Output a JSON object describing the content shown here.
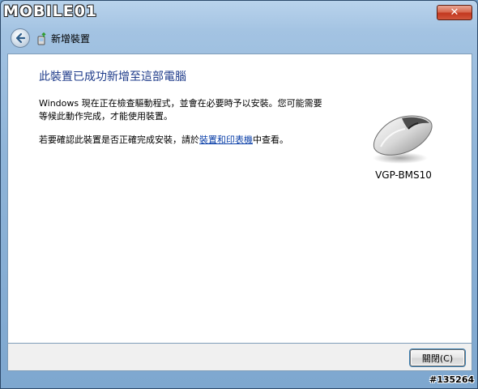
{
  "watermark": {
    "logo_text": "MOBILE01",
    "id": "#135264"
  },
  "titlebar": {
    "close_label": "✕"
  },
  "nav": {
    "title": "新增裝置"
  },
  "content": {
    "heading": "此裝置已成功新增至這部電腦",
    "para1": "Windows 現在正在檢查驅動程式，並會在必要時予以安裝。您可能需要等候此動作完成，才能使用裝置。",
    "para2_before": "若要確認此裝置是否正確完成安裝，請於",
    "para2_link": "裝置和印表機",
    "para2_after": "中查看。",
    "device_name": "VGP-BMS10"
  },
  "footer": {
    "close_button": "關閉(C)"
  }
}
